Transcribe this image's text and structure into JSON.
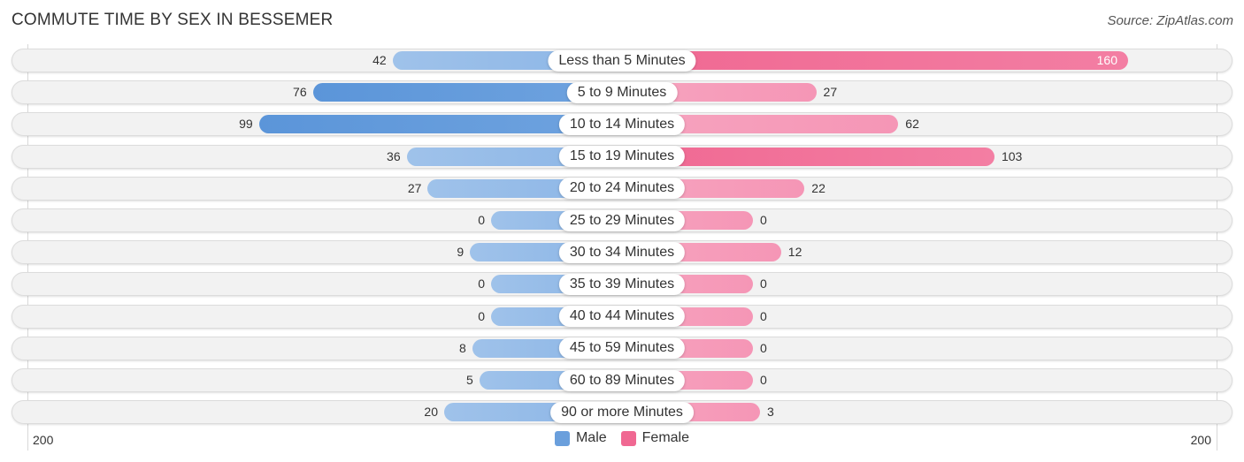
{
  "title": "COMMUTE TIME BY SEX IN BESSEMER",
  "source": "Source: ZipAtlas.com",
  "colors": {
    "male": "#6a9fdc",
    "male_light": "#9fc2ea",
    "female": "#f06892",
    "female_light": "#f7a4bf"
  },
  "chart_data": {
    "type": "bar",
    "orientation": "horizontal-diverging",
    "title": "COMMUTE TIME BY SEX IN BESSEMER",
    "categories": [
      "Less than 5 Minutes",
      "5 to 9 Minutes",
      "10 to 14 Minutes",
      "15 to 19 Minutes",
      "20 to 24 Minutes",
      "25 to 29 Minutes",
      "30 to 34 Minutes",
      "35 to 39 Minutes",
      "40 to 44 Minutes",
      "45 to 59 Minutes",
      "60 to 89 Minutes",
      "90 or more Minutes"
    ],
    "series": [
      {
        "name": "Male",
        "side": "left",
        "values": [
          42,
          76,
          99,
          36,
          27,
          0,
          9,
          0,
          0,
          8,
          5,
          20
        ]
      },
      {
        "name": "Female",
        "side": "right",
        "values": [
          160,
          27,
          62,
          103,
          22,
          0,
          12,
          0,
          0,
          0,
          0,
          3
        ]
      }
    ],
    "axis": {
      "left_label": "200",
      "right_label": "200",
      "range": [
        0,
        200
      ]
    },
    "legend": {
      "position": "bottom-center",
      "entries": [
        "Male",
        "Female"
      ]
    },
    "grid": false
  }
}
